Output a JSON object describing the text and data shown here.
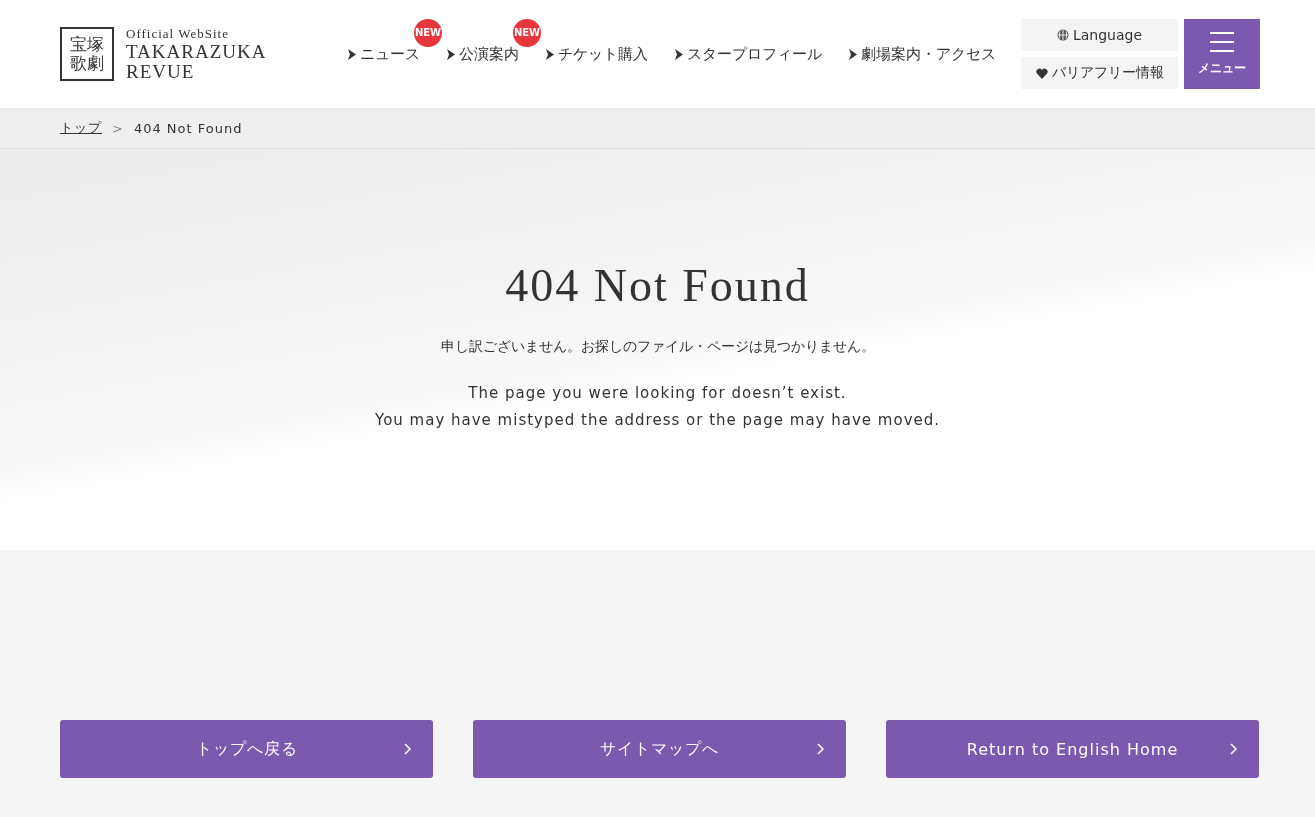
{
  "logo": {
    "seal": [
      "宝塚",
      "歌劇"
    ],
    "tagline": "Official WebSite",
    "title": [
      "TAKARAZUKA",
      "REVUE"
    ]
  },
  "nav": [
    {
      "label": "ニュース",
      "badge": "NEW"
    },
    {
      "label": "公演案内",
      "badge": "NEW"
    },
    {
      "label": "チケット購入"
    },
    {
      "label": "スタープロフィール"
    },
    {
      "label": "劇場案内・アクセス"
    }
  ],
  "utility": {
    "language": "Language",
    "accessibility": "バリアフリー情報",
    "menu": "メニュー"
  },
  "breadcrumb": {
    "link": "トップ",
    "separator": ">",
    "current": "404 Not Found"
  },
  "error": {
    "heading": "404 Not Found",
    "message_ja": "申し訳ございません。お探しのファイル・ページは見つかりません。",
    "message_en": [
      "The page you were looking for doesn’t exist.",
      "You may have mistyped the address or the page may have moved."
    ]
  },
  "buttons": [
    "トップへ戻る",
    "サイトマップへ",
    "Return to English Home"
  ]
}
